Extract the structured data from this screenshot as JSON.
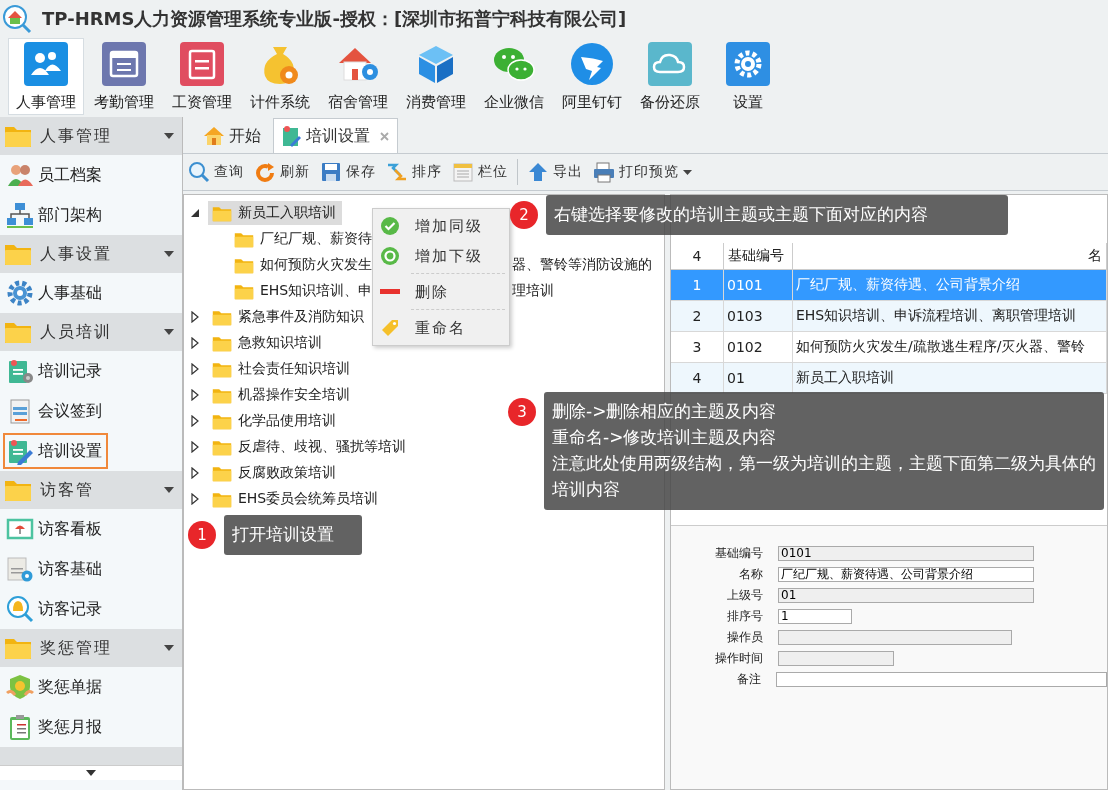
{
  "window": {
    "title": "TP-HRMS人力资源管理系统专业版-授权：[深圳市拓普宁科技有限公司]"
  },
  "modules": [
    {
      "label": "人事管理",
      "selected": true
    },
    {
      "label": "考勤管理",
      "selected": false
    },
    {
      "label": "工资管理",
      "selected": false
    },
    {
      "label": "计件系统",
      "selected": false
    },
    {
      "label": "宿舍管理",
      "selected": false
    },
    {
      "label": "消费管理",
      "selected": false
    },
    {
      "label": "企业微信",
      "selected": false
    },
    {
      "label": "阿里钉钉",
      "selected": false
    },
    {
      "label": "备份还原",
      "selected": false
    },
    {
      "label": "设置",
      "selected": false
    }
  ],
  "sidebar": {
    "items": [
      {
        "kind": "group",
        "label": "人事管理",
        "selected": false
      },
      {
        "kind": "item",
        "label": "员工档案",
        "selected": false
      },
      {
        "kind": "item",
        "label": "部门架构",
        "selected": false
      },
      {
        "kind": "group",
        "label": "人事设置",
        "selected": false
      },
      {
        "kind": "item",
        "label": "人事基础",
        "selected": false
      },
      {
        "kind": "group",
        "label": "人员培训",
        "selected": false
      },
      {
        "kind": "item",
        "label": "培训记录",
        "selected": false
      },
      {
        "kind": "item",
        "label": "会议签到",
        "selected": false
      },
      {
        "kind": "item",
        "label": "培训设置",
        "selected": true
      },
      {
        "kind": "group",
        "label": "访客管",
        "selected": false
      },
      {
        "kind": "item",
        "label": "访客看板",
        "selected": false
      },
      {
        "kind": "item",
        "label": "访客基础",
        "selected": false
      },
      {
        "kind": "item",
        "label": "访客记录",
        "selected": false
      },
      {
        "kind": "group",
        "label": "奖惩管理",
        "selected": false
      },
      {
        "kind": "item",
        "label": "奖惩单据",
        "selected": false
      },
      {
        "kind": "item",
        "label": "奖惩月报",
        "selected": false
      }
    ]
  },
  "tabs": [
    {
      "label": "开始",
      "selected": false,
      "closable": false
    },
    {
      "label": "培训设置",
      "selected": true,
      "closable": true
    }
  ],
  "toolbar": [
    {
      "label": "查询",
      "dropdown": false
    },
    {
      "label": "刷新",
      "dropdown": false
    },
    {
      "label": "保存",
      "dropdown": false
    },
    {
      "label": "排序",
      "dropdown": false
    },
    {
      "label": "栏位",
      "dropdown": false
    },
    {
      "label": "导出",
      "dropdown": false
    },
    {
      "label": "打印预览",
      "dropdown": true
    }
  ],
  "tree": [
    {
      "parts": [
        "新员工入职培训"
      ],
      "expanded": true,
      "selected": true,
      "children": [
        {
          "parts": [
            "厂纪厂规、薪资待"
          ],
          "selected": false
        },
        {
          "parts": [
            "如何预防火灾发生",
            "器、警铃等消防设施的"
          ],
          "selected": false
        },
        {
          "parts": [
            "EHS知识培训、申",
            "理培训"
          ],
          "selected": false
        }
      ]
    },
    {
      "parts": [
        "紧急事件及消防知识"
      ],
      "expanded": false,
      "selected": false
    },
    {
      "parts": [
        "急救知识培训"
      ],
      "expanded": false,
      "selected": false
    },
    {
      "parts": [
        "社会责任知识培训"
      ],
      "expanded": false,
      "selected": false
    },
    {
      "parts": [
        "机器操作安全培训"
      ],
      "expanded": false,
      "selected": false
    },
    {
      "parts": [
        "化学品使用培训"
      ],
      "expanded": false,
      "selected": false
    },
    {
      "parts": [
        "反虐待、歧视、骚扰等培训"
      ],
      "expanded": false,
      "selected": false
    },
    {
      "parts": [
        "反腐败政策培训"
      ],
      "expanded": false,
      "selected": false
    },
    {
      "parts": [
        "EHS委员会统筹员培训"
      ],
      "expanded": false,
      "selected": false
    }
  ],
  "context_menu": [
    {
      "label": "增加同级",
      "kind": "check"
    },
    {
      "label": "增加下级",
      "kind": "ring"
    },
    {
      "label": "删除",
      "kind": "minus"
    },
    {
      "label": "重命名",
      "kind": "tag"
    }
  ],
  "table": {
    "columns": [
      "4",
      "基础编号",
      "名"
    ],
    "rows": [
      {
        "cells": [
          "1",
          "0101",
          "厂纪厂规、薪资待遇、公司背景介绍"
        ],
        "selected": true
      },
      {
        "cells": [
          "2",
          "0103",
          "EHS知识培训、申诉流程培训、离职管理培训"
        ],
        "selected": false
      },
      {
        "cells": [
          "3",
          "0102",
          "如何预防火灾发生/疏散逃生程序/灭火器、警铃"
        ],
        "selected": false
      },
      {
        "cells": [
          "4",
          "01",
          "新员工入职培训"
        ],
        "selected": false
      }
    ]
  },
  "form": [
    {
      "label": "基础编号",
      "value": "0101",
      "readonly": true
    },
    {
      "label": "名称",
      "value": "厂纪厂规、薪资待遇、公司背景介绍",
      "readonly": false
    },
    {
      "label": "上级号",
      "value": "01",
      "readonly": true
    },
    {
      "label": "排序号",
      "value": "1",
      "readonly": false
    },
    {
      "label": "操作员",
      "readonly": true
    },
    {
      "label": "操作时间",
      "readonly": true
    },
    {
      "label": "备注",
      "readonly": false
    }
  ],
  "callouts": [
    {
      "number": "1",
      "lines": [
        "打开培训设置"
      ]
    },
    {
      "number": "2",
      "lines": [
        "右键选择要修改的培训主题或主题下面对应的内容"
      ]
    },
    {
      "number": "3",
      "lines": [
        "删除->删除相应的主题及内容",
        "重命名->修改培训主题及内容",
        "注意此处使用两级结构，第一级为培训的主题，主题下面第二级为具体的培训内容"
      ]
    }
  ]
}
